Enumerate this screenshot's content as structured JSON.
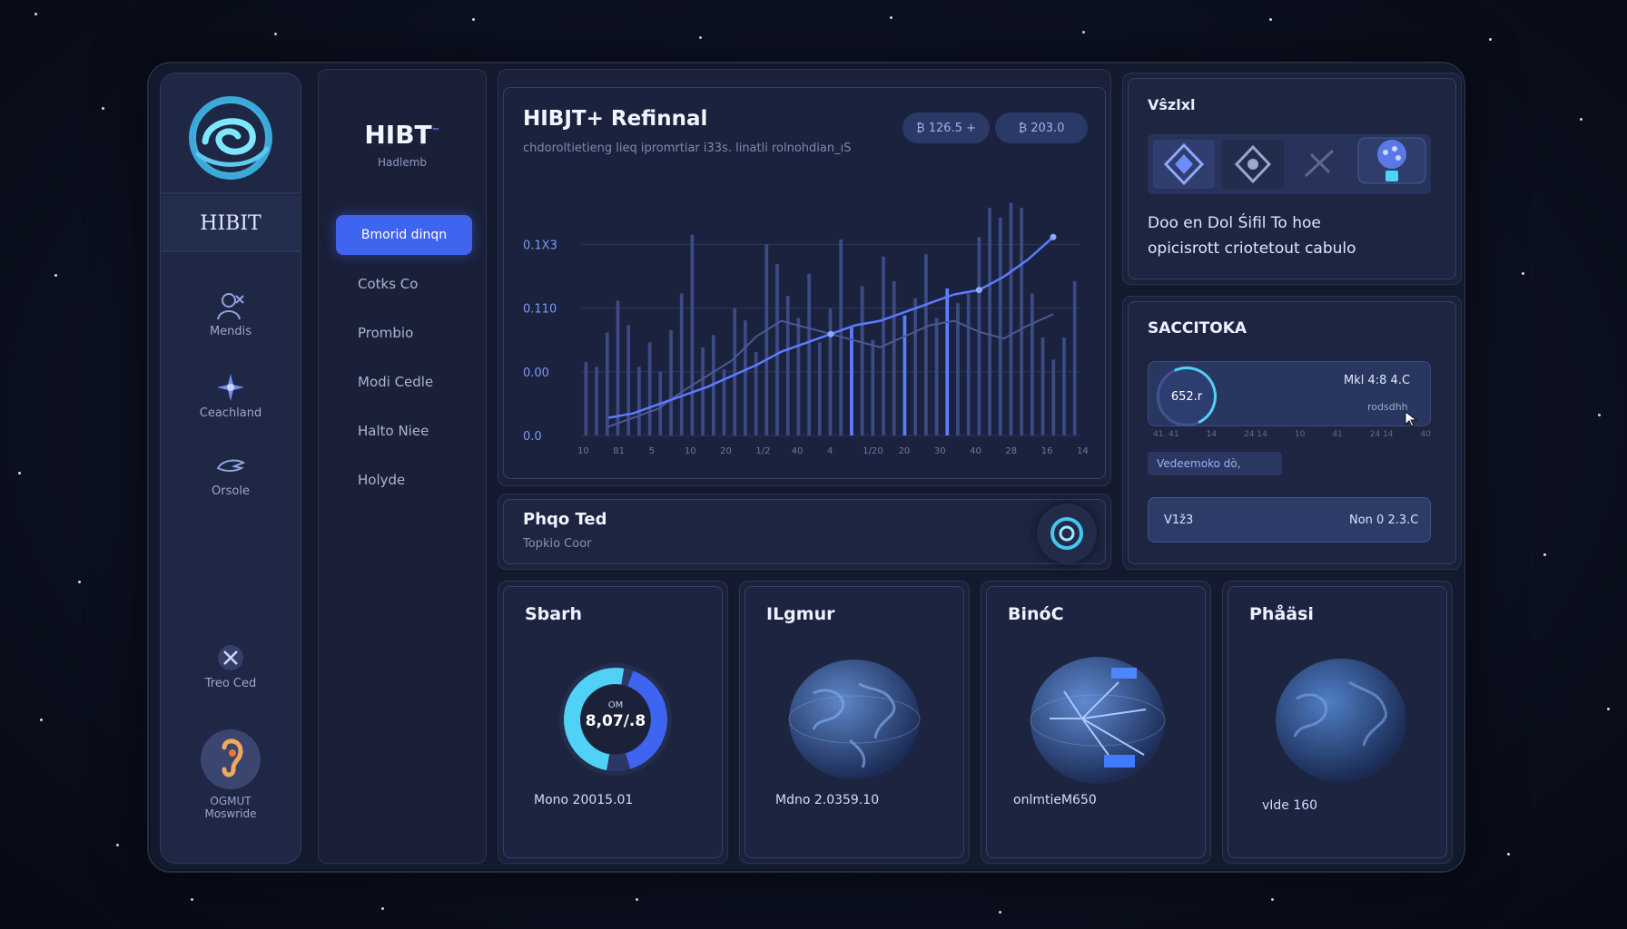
{
  "app": {
    "name": "HIBT",
    "logo_icon": "swirl-logo-icon"
  },
  "rail": {
    "brand": "HIBIT",
    "items": [
      {
        "label": "Mendis",
        "icon": "person-icon"
      },
      {
        "label": "Ceachland",
        "icon": "spark-icon"
      },
      {
        "label": "Orsole",
        "icon": "wing-icon"
      },
      {
        "label": "Treo Ced",
        "icon": "support-icon"
      }
    ],
    "profile": {
      "line1": "OGMUT",
      "line2": "Moswride",
      "icon": "ear-avatar-icon"
    }
  },
  "nav": {
    "title": "HIBT",
    "title_sup": "™",
    "subtitle": "Hadlemb",
    "active": "Bmorid dinqn",
    "items": [
      "Cotks Co",
      "Prombio",
      "Modi Cedle",
      "Halto Niee",
      "Holyde"
    ]
  },
  "chart_panel": {
    "title": "HIBJT+ Refinnal",
    "subtitle": "chdoroltietieng lieq ipromrtiar i33s. linatli rolnohdian_ıS",
    "pills": [
      "₿ 126.5 +",
      "₿ 203.0"
    ]
  },
  "chart_data": {
    "type": "bar",
    "y_tick_labels": [
      "0.1X3",
      "0.110",
      "0.00",
      "0.0"
    ],
    "x_tick_labels": [
      "10",
      "81",
      "5",
      "10",
      "20",
      "1/2",
      "40",
      "4",
      "1/20",
      "20",
      "30",
      "40",
      "28",
      "16",
      "14"
    ],
    "bars": [
      0.3,
      0.28,
      0.42,
      0.55,
      0.45,
      0.28,
      0.38,
      0.26,
      0.43,
      0.58,
      0.82,
      0.36,
      0.41,
      0.27,
      0.52,
      0.47,
      0.34,
      0.78,
      0.7,
      0.57,
      0.48,
      0.66,
      0.38,
      0.52,
      0.8,
      0.44,
      0.61,
      0.39,
      0.73,
      0.63,
      0.49,
      0.56,
      0.74,
      0.48,
      0.6,
      0.54,
      0.58,
      0.81,
      0.93,
      0.89,
      0.95,
      0.93,
      0.58,
      0.4,
      0.31,
      0.4,
      0.63
    ],
    "highlight_bars": [
      25,
      30,
      34
    ],
    "line": [
      0.08,
      0.1,
      0.14,
      0.18,
      0.22,
      0.27,
      0.32,
      0.38,
      0.42,
      0.46,
      0.5,
      0.52,
      0.56,
      0.6,
      0.64,
      0.66,
      0.72,
      0.8,
      0.9
    ],
    "line2": [
      0.04,
      0.08,
      0.12,
      0.2,
      0.27,
      0.34,
      0.45,
      0.52,
      0.49,
      0.46,
      0.43,
      0.4,
      0.45,
      0.5,
      0.52,
      0.47,
      0.44,
      0.5,
      0.55
    ],
    "ylim": [
      0,
      1
    ],
    "colors": {
      "bar": "#3a4b86",
      "bar_highlight": "#5d7dff",
      "line": "#5c7bff",
      "line2": "#4a5993"
    }
  },
  "phone_bar": {
    "title": "Phqo Ted",
    "subtitle": "Topkio Coor",
    "button_icon": "target-icon"
  },
  "right_top": {
    "title": "Vŝzlxl",
    "line1": "Doo en Dol Śifil To hoe",
    "line2": "opicisrott criotetout cabulo",
    "icons": [
      "diamond-shield-icon",
      "eye-diamond-icon",
      "satellite-icon",
      "cloud-lock-icon"
    ]
  },
  "right_mid": {
    "title": "SACCITOKA",
    "ring_value": "652.r",
    "value": "Mkl 4:8 4.C",
    "small": "rodsdhh",
    "ticks": [
      "41. 41",
      "14",
      "24 14",
      "10",
      "41",
      "24 14",
      "40"
    ],
    "tag": "Vedeemoko dò,",
    "bar_left": "V1ž3",
    "bar_right": "Non 0 2.3.C"
  },
  "cards": [
    {
      "title": "Sbarh",
      "footer": "Mono 20015.01",
      "donut_top": "OM",
      "donut_value": "8,07/.8",
      "visual": "donut"
    },
    {
      "title": "ILgmur",
      "footer": "Mdno 2.0359.10",
      "visual": "globe"
    },
    {
      "title": "BinóC",
      "footer": "onlmtieM650",
      "visual": "globe-network"
    },
    {
      "title": "Phåäsi",
      "footer": "vIde 160",
      "visual": "globe"
    }
  ]
}
